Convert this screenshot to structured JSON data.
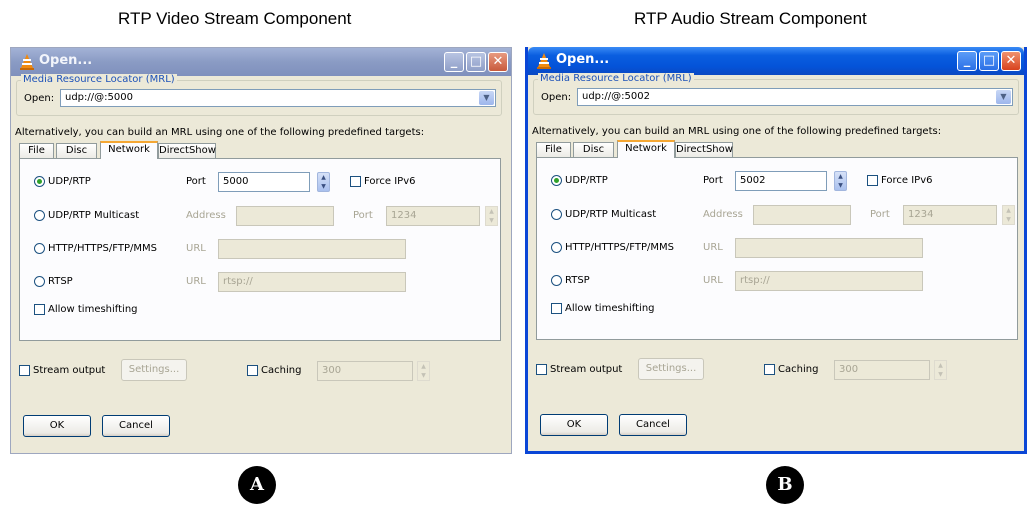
{
  "captions": {
    "a": "RTP Video Stream Component",
    "b": "RTP Audio Stream Component"
  },
  "badges": {
    "a": "A",
    "b": "B"
  },
  "dialogs": [
    {
      "title": "Open...",
      "mrl_legend": "Media Resource Locator (MRL)",
      "open_label": "Open:",
      "open_value": "udp://@:5000",
      "alt_text": "Alternatively, you can build an MRL using one of the following predefined targets:",
      "tabs": [
        "File",
        "Disc",
        "Network",
        "DirectShow"
      ],
      "active_tab": "Network",
      "udp": {
        "label": "UDP/RTP",
        "port_label": "Port",
        "port_value": "5000",
        "force_ipv6": "Force IPv6"
      },
      "multicast": {
        "label": "UDP/RTP Multicast",
        "address_label": "Address",
        "port_label": "Port",
        "port_value": "1234"
      },
      "http": {
        "label": "HTTP/HTTPS/FTP/MMS",
        "url_label": "URL"
      },
      "rtsp": {
        "label": "RTSP",
        "url_label": "URL",
        "url_value": "rtsp://"
      },
      "timeshift": "Allow timeshifting",
      "stream_output": "Stream output",
      "settings": "Settings...",
      "caching": "Caching",
      "caching_value": "300",
      "ok": "OK",
      "cancel": "Cancel"
    },
    {
      "title": "Open...",
      "mrl_legend": "Media Resource Locator (MRL)",
      "open_label": "Open:",
      "open_value": "udp://@:5002",
      "alt_text": "Alternatively, you can build an MRL using one of the following predefined targets:",
      "tabs": [
        "File",
        "Disc",
        "Network",
        "DirectShow"
      ],
      "active_tab": "Network",
      "udp": {
        "label": "UDP/RTP",
        "port_label": "Port",
        "port_value": "5002",
        "force_ipv6": "Force IPv6"
      },
      "multicast": {
        "label": "UDP/RTP Multicast",
        "address_label": "Address",
        "port_label": "Port",
        "port_value": "1234"
      },
      "http": {
        "label": "HTTP/HTTPS/FTP/MMS",
        "url_label": "URL"
      },
      "rtsp": {
        "label": "RTSP",
        "url_label": "URL",
        "url_value": "rtsp://"
      },
      "timeshift": "Allow timeshifting",
      "stream_output": "Stream output",
      "settings": "Settings...",
      "caching": "Caching",
      "caching_value": "300",
      "ok": "OK",
      "cancel": "Cancel"
    }
  ],
  "colors": {
    "active_titlebar": "#0453d8",
    "inactive_titlebar": "#8a9bc4",
    "tab_highlight": "#f5a733",
    "legend_text": "#1c51b8"
  },
  "icons": {
    "app": "vlc-cone-icon",
    "minimize": "minimize-icon",
    "maximize": "maximize-icon",
    "close": "close-icon",
    "dropdown": "chevron-down-icon"
  }
}
